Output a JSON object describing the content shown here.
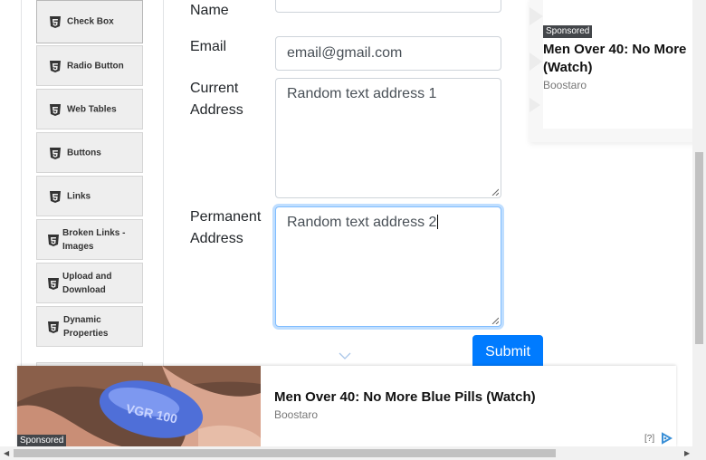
{
  "sidebar": {
    "items": [
      {
        "label": "Check Box",
        "icon": "html5-icon"
      },
      {
        "label": "Radio Button",
        "icon": "html5-icon"
      },
      {
        "label": "Web Tables",
        "icon": "html5-icon"
      },
      {
        "label": "Buttons",
        "icon": "html5-icon"
      },
      {
        "label": "Links",
        "icon": "html5-icon"
      },
      {
        "label": "Broken Links - Images",
        "icon": "html5-icon"
      },
      {
        "label": "Upload and Download",
        "icon": "html5-icon"
      },
      {
        "label": "Dynamic Properties",
        "icon": "html5-icon"
      }
    ]
  },
  "form": {
    "name_label": "Name",
    "name_value": "__",
    "email_label": "Email",
    "email_value": "email@gmail.com",
    "current_address_label": "Current Address",
    "current_address_value": "Random text address 1",
    "permanent_address_label": "Permanent Address",
    "permanent_address_value": "Random text address 2",
    "submit_label": "Submit"
  },
  "ad_top": {
    "sponsored": "Sponsored",
    "title": "Men Over 40: No More",
    "title_suffix": "(Watch)",
    "brand": "Boostaro"
  },
  "ad_bottom": {
    "sponsored": "Sponsored",
    "pill_text": "VGR 100",
    "title": "Men Over 40: No More Blue Pills (Watch)",
    "brand": "Boostaro",
    "help": "[?]"
  },
  "colors": {
    "accent": "#007bff",
    "focus_border": "#80bdff",
    "sidebar_item_bg": "#eeeeee",
    "sponsored_bg": "#43464a"
  }
}
